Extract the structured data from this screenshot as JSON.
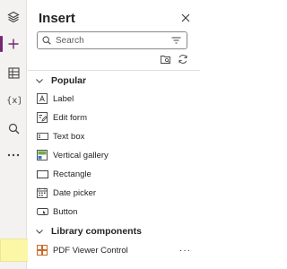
{
  "panel": {
    "title": "Insert",
    "search_placeholder": "Search"
  },
  "rail": {
    "items": [
      {
        "icon": "layers-icon"
      },
      {
        "icon": "plus-icon",
        "active": true
      },
      {
        "icon": "grid-icon"
      },
      {
        "icon": "variable-icon"
      },
      {
        "icon": "search-icon"
      },
      {
        "icon": "more-icon"
      }
    ]
  },
  "sections": {
    "popular": {
      "label": "Popular",
      "items": [
        {
          "label": "Label",
          "icon": "label-icon"
        },
        {
          "label": "Edit form",
          "icon": "edit-form-icon"
        },
        {
          "label": "Text box",
          "icon": "text-box-icon"
        },
        {
          "label": "Vertical gallery",
          "icon": "vertical-gallery-icon"
        },
        {
          "label": "Rectangle",
          "icon": "rectangle-icon"
        },
        {
          "label": "Date picker",
          "icon": "date-picker-icon"
        },
        {
          "label": "Button",
          "icon": "button-icon"
        }
      ]
    },
    "library": {
      "label": "Library components",
      "items": [
        {
          "label": "PDF Viewer Control",
          "icon": "component-icon",
          "more": "···"
        }
      ]
    }
  },
  "colors": {
    "accent": "#742774",
    "highlight": "#fbf7a6"
  }
}
